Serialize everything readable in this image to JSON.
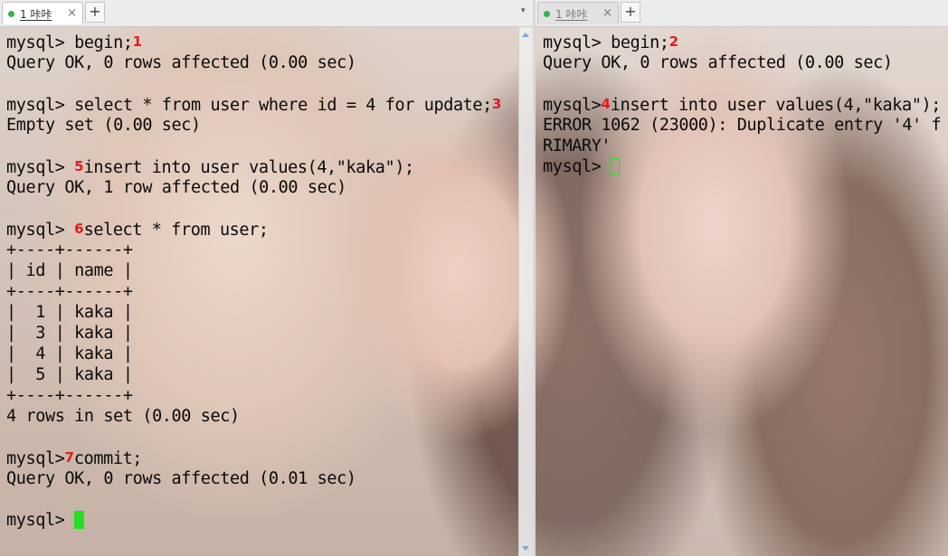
{
  "tabs": {
    "left": {
      "label": "1 咔咔",
      "close": "×",
      "add": "+",
      "dropdown": "▾"
    },
    "right": {
      "label": "1 咔咔",
      "close": "×",
      "add": "+"
    }
  },
  "left_terminal": {
    "lines": [
      {
        "prefix": "mysql> begin;",
        "mark": "1",
        "suffix": ""
      },
      {
        "prefix": "Query OK, 0 rows affected (0.00 sec)",
        "mark": "",
        "suffix": ""
      },
      {
        "prefix": "",
        "mark": "",
        "suffix": ""
      },
      {
        "prefix": "mysql> select * from user where id = 4 for update;",
        "mark": "3",
        "suffix": ""
      },
      {
        "prefix": "Empty set (0.00 sec)",
        "mark": "",
        "suffix": ""
      },
      {
        "prefix": "",
        "mark": "",
        "suffix": ""
      },
      {
        "prefix": "mysql> ",
        "mark": "5",
        "suffix": "insert into user values(4,\"kaka\");"
      },
      {
        "prefix": "Query OK, 1 row affected (0.00 sec)",
        "mark": "",
        "suffix": ""
      },
      {
        "prefix": "",
        "mark": "",
        "suffix": ""
      },
      {
        "prefix": "mysql> ",
        "mark": "6",
        "suffix": "select * from user;"
      },
      {
        "prefix": "+----+------+",
        "mark": "",
        "suffix": ""
      },
      {
        "prefix": "| id | name |",
        "mark": "",
        "suffix": ""
      },
      {
        "prefix": "+----+------+",
        "mark": "",
        "suffix": ""
      },
      {
        "prefix": "|  1 | kaka |",
        "mark": "",
        "suffix": ""
      },
      {
        "prefix": "|  3 | kaka |",
        "mark": "",
        "suffix": ""
      },
      {
        "prefix": "|  4 | kaka |",
        "mark": "",
        "suffix": ""
      },
      {
        "prefix": "|  5 | kaka |",
        "mark": "",
        "suffix": ""
      },
      {
        "prefix": "+----+------+",
        "mark": "",
        "suffix": ""
      },
      {
        "prefix": "4 rows in set (0.00 sec)",
        "mark": "",
        "suffix": ""
      },
      {
        "prefix": "",
        "mark": "",
        "suffix": ""
      },
      {
        "prefix": "mysql>",
        "mark": "7",
        "suffix": "commit;"
      },
      {
        "prefix": "Query OK, 0 rows affected (0.01 sec)",
        "mark": "",
        "suffix": ""
      },
      {
        "prefix": "",
        "mark": "",
        "suffix": ""
      }
    ],
    "prompt": "mysql> "
  },
  "right_terminal": {
    "lines": [
      {
        "prefix": "mysql> begin;",
        "mark": "2",
        "suffix": ""
      },
      {
        "prefix": "Query OK, 0 rows affected (0.00 sec)",
        "mark": "",
        "suffix": ""
      },
      {
        "prefix": "",
        "mark": "",
        "suffix": ""
      },
      {
        "prefix": "mysql>",
        "mark": "4",
        "suffix": "insert into user values(4,\"kaka\");"
      },
      {
        "prefix": "ERROR 1062 (23000): Duplicate entry '4' f",
        "mark": "",
        "suffix": ""
      },
      {
        "prefix": "RIMARY'",
        "mark": "",
        "suffix": ""
      }
    ],
    "prompt": "mysql> "
  },
  "colors": {
    "annotation": "#e31b1b",
    "cursor": "#23e023",
    "session_indicator": "#2fb54a"
  }
}
